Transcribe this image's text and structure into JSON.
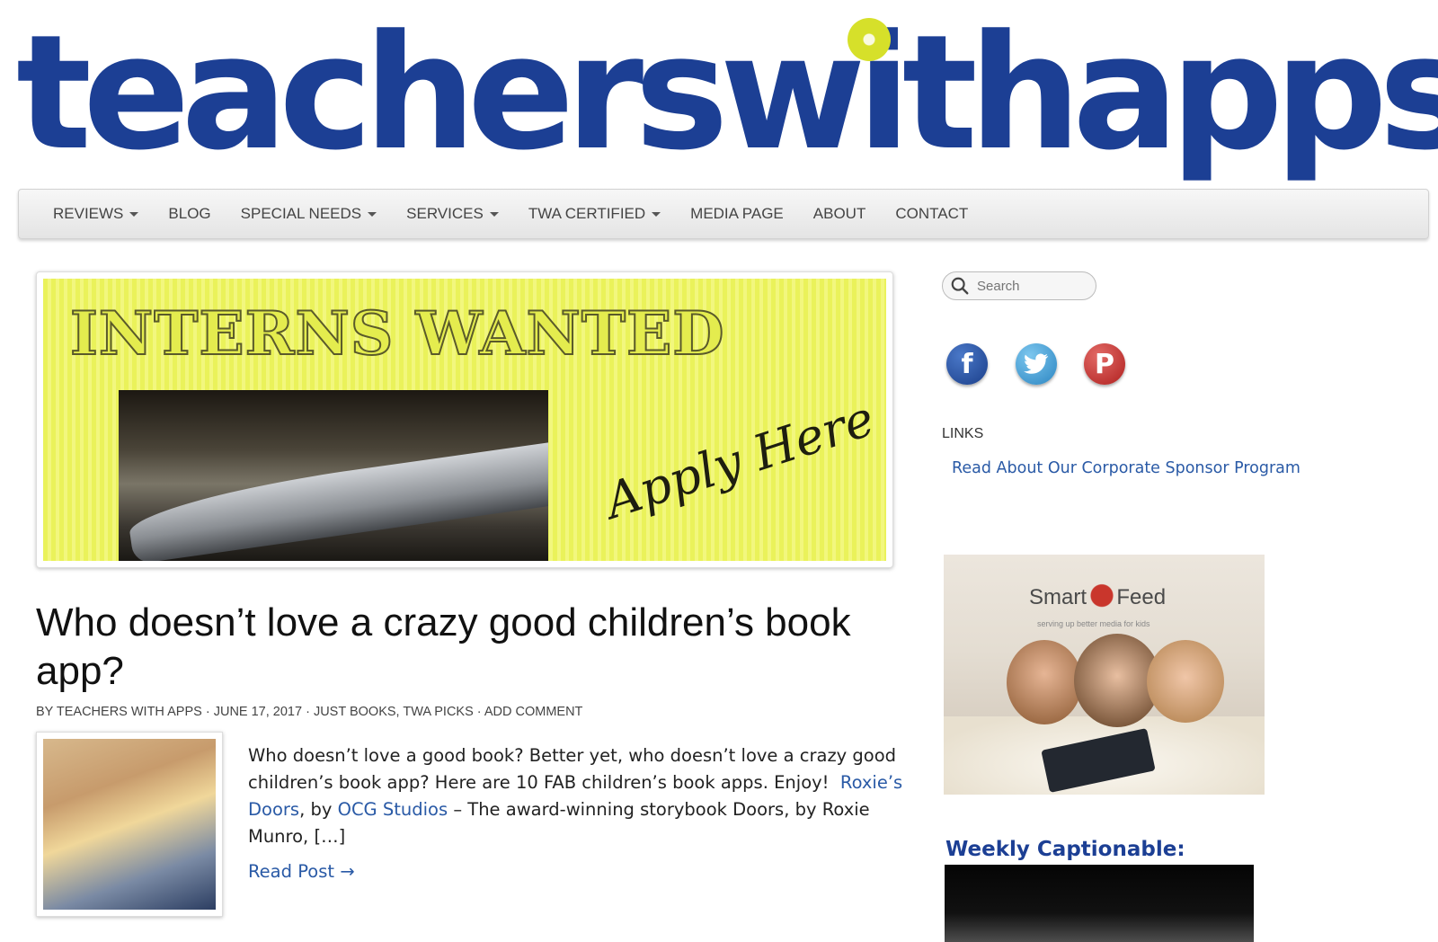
{
  "logo": {
    "text": "teacherswithapps"
  },
  "nav": {
    "items": [
      {
        "label": "REVIEWS",
        "dropdown": true
      },
      {
        "label": "BLOG",
        "dropdown": false
      },
      {
        "label": "SPECIAL NEEDS",
        "dropdown": true
      },
      {
        "label": "SERVICES",
        "dropdown": true
      },
      {
        "label": "TWA CERTIFIED",
        "dropdown": true
      },
      {
        "label": "MEDIA PAGE",
        "dropdown": false
      },
      {
        "label": "ABOUT",
        "dropdown": false
      },
      {
        "label": "CONTACT",
        "dropdown": false
      }
    ]
  },
  "banner": {
    "title": "INTERNS WANTED",
    "cta": "Apply Here"
  },
  "post": {
    "title": "Who doesn’t love a crazy good children’s book app?",
    "meta": {
      "by": "BY",
      "author": "TEACHERS WITH APPS",
      "date": "JUNE 17, 2017",
      "categories": "JUST BOOKS, TWA PICKS",
      "comment": "ADD COMMENT"
    },
    "excerpt": {
      "intro": "Who doesn’t love a good book? Better yet, who doesn’t love a crazy good children’s book app? Here are 10 FAB children’s book apps. Enjoy!",
      "link1": "Roxie’s Doors",
      "by": ", by",
      "link2": "OCG Studios",
      "rest": " – The award-winning storybook Doors, by Roxie Munro, […]"
    },
    "read_more": "Read Post →"
  },
  "sidebar": {
    "search_placeholder": "Search",
    "social": [
      "facebook-icon",
      "twitter-icon",
      "pinterest-icon"
    ],
    "links_heading": "LINKS",
    "links": [
      "Read About Our Corporate Sponsor Program"
    ],
    "ad": {
      "brand_left": "Smart",
      "brand_right": "Feed",
      "tagline": "serving up better media for kids"
    },
    "weekly_heading": "Weekly Captionable:"
  },
  "colors": {
    "brand_blue": "#1c3f94",
    "link_blue": "#2a5aa6",
    "banner_yellow": "#eaf25a"
  }
}
